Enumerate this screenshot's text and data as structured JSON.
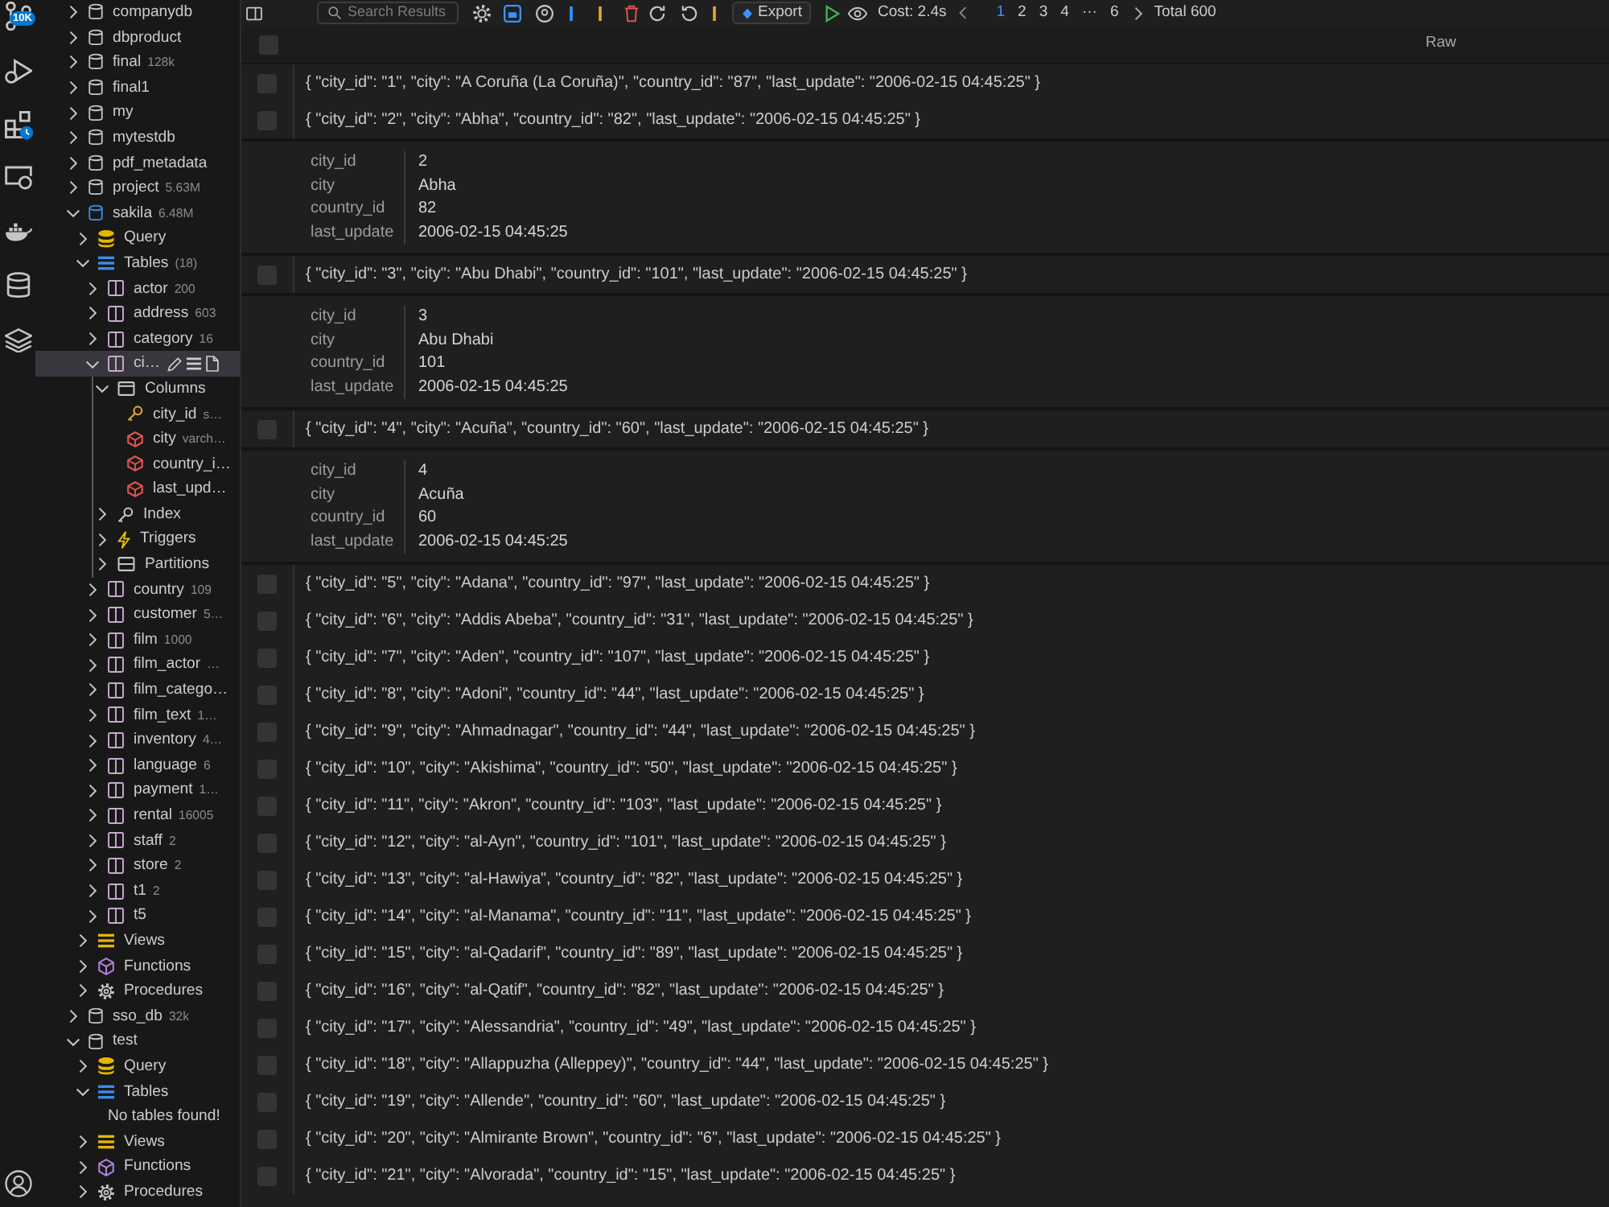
{
  "activity_bar": {
    "badge": "10K"
  },
  "sidebar": {
    "tree": [
      {
        "kind": "database",
        "label": "companydb",
        "expanded": false,
        "selected": false,
        "active": false
      },
      {
        "kind": "database",
        "label": "dbproduct",
        "expanded": false,
        "selected": false,
        "active": false
      },
      {
        "kind": "database",
        "label": "final",
        "meta": "128k",
        "expanded": false,
        "selected": false,
        "active": false
      },
      {
        "kind": "database",
        "label": "final1",
        "expanded": false,
        "selected": false,
        "active": false
      },
      {
        "kind": "database",
        "label": "my",
        "expanded": false,
        "selected": false,
        "active": false
      },
      {
        "kind": "database",
        "label": "mytestdb",
        "expanded": false,
        "selected": false,
        "active": false
      },
      {
        "kind": "database",
        "label": "pdf_metadata",
        "expanded": false,
        "selected": false,
        "active": false
      },
      {
        "kind": "database",
        "label": "project",
        "meta": "5.63M",
        "expanded": false,
        "selected": false,
        "active": false
      },
      {
        "kind": "database",
        "label": "sakila",
        "meta": "6.48M",
        "expanded": true,
        "selected": false,
        "active": true,
        "children": [
          {
            "kind": "query",
            "label": "Query",
            "expanded": false,
            "selected": false
          },
          {
            "kind": "tables",
            "label": "Tables",
            "meta": "(18)",
            "expanded": true,
            "selected": false,
            "children": [
              {
                "kind": "table",
                "label": "actor",
                "meta": "200",
                "expanded": false,
                "selected": false
              },
              {
                "kind": "table",
                "label": "address",
                "meta": "603",
                "expanded": false,
                "selected": false
              },
              {
                "kind": "table",
                "label": "category",
                "meta": "16",
                "expanded": false,
                "selected": false
              },
              {
                "kind": "table",
                "label": "ci…",
                "expanded": true,
                "selected": true,
                "children": [
                  {
                    "kind": "columns",
                    "label": "Columns",
                    "expanded": true,
                    "selected": false,
                    "children": [
                      {
                        "kind": "key",
                        "label": "city_id",
                        "meta": "s…",
                        "selected": false
                      },
                      {
                        "kind": "column",
                        "label": "city",
                        "meta": "varch…",
                        "selected": false
                      },
                      {
                        "kind": "column",
                        "label": "country_i…",
                        "selected": false
                      },
                      {
                        "kind": "column",
                        "label": "last_upd…",
                        "selected": false
                      }
                    ]
                  },
                  {
                    "kind": "index",
                    "label": "Index",
                    "expanded": false,
                    "selected": false
                  },
                  {
                    "kind": "triggers",
                    "label": "Triggers",
                    "expanded": false,
                    "selected": false
                  },
                  {
                    "kind": "partitions",
                    "label": "Partitions",
                    "expanded": false,
                    "selected": false
                  }
                ]
              },
              {
                "kind": "table",
                "label": "country",
                "meta": "109",
                "expanded": false,
                "selected": false
              },
              {
                "kind": "table",
                "label": "customer",
                "meta": "5…",
                "expanded": false,
                "selected": false
              },
              {
                "kind": "table",
                "label": "film",
                "meta": "1000",
                "expanded": false,
                "selected": false
              },
              {
                "kind": "table",
                "label": "film_actor",
                "meta": "…",
                "expanded": false,
                "selected": false
              },
              {
                "kind": "table",
                "label": "film_catego…",
                "expanded": false,
                "selected": false
              },
              {
                "kind": "table",
                "label": "film_text",
                "meta": "1…",
                "expanded": false,
                "selected": false
              },
              {
                "kind": "table",
                "label": "inventory",
                "meta": "4…",
                "expanded": false,
                "selected": false
              },
              {
                "kind": "table",
                "label": "language",
                "meta": "6",
                "expanded": false,
                "selected": false
              },
              {
                "kind": "table",
                "label": "payment",
                "meta": "1…",
                "expanded": false,
                "selected": false
              },
              {
                "kind": "table",
                "label": "rental",
                "meta": "16005",
                "expanded": false,
                "selected": false
              },
              {
                "kind": "table",
                "label": "staff",
                "meta": "2",
                "expanded": false,
                "selected": false
              },
              {
                "kind": "table",
                "label": "store",
                "meta": "2",
                "expanded": false,
                "selected": false
              },
              {
                "kind": "table",
                "label": "t1",
                "meta": "2",
                "expanded": false,
                "selected": false
              },
              {
                "kind": "table",
                "label": "t5",
                "expanded": false,
                "selected": false
              }
            ]
          },
          {
            "kind": "views",
            "label": "Views",
            "expanded": false,
            "selected": false
          },
          {
            "kind": "functions",
            "label": "Functions",
            "expanded": false,
            "selected": false
          },
          {
            "kind": "procedures",
            "label": "Procedures",
            "expanded": false,
            "selected": false
          }
        ]
      },
      {
        "kind": "database",
        "label": "sso_db",
        "meta": "32k",
        "expanded": false,
        "selected": false,
        "active": false
      },
      {
        "kind": "database",
        "label": "test",
        "expanded": true,
        "selected": false,
        "active": false,
        "children": [
          {
            "kind": "query",
            "label": "Query",
            "expanded": false,
            "selected": false
          },
          {
            "kind": "tables",
            "label": "Tables",
            "expanded": true,
            "selected": false,
            "children": [
              {
                "kind": "message",
                "label": "No tables found!",
                "selected": false
              }
            ]
          },
          {
            "kind": "views",
            "label": "Views",
            "expanded": false,
            "selected": false
          },
          {
            "kind": "functions",
            "label": "Functions",
            "expanded": false,
            "selected": false
          },
          {
            "kind": "procedures",
            "label": "Procedures",
            "expanded": false,
            "selected": false
          }
        ]
      }
    ]
  },
  "toolbar": {
    "search": {
      "placeholder": "Search Results"
    },
    "export": "Export",
    "cost": "Cost: 2.4s",
    "pages": [
      {
        "label": "1",
        "selected": true
      },
      {
        "label": "2",
        "selected": false
      },
      {
        "label": "3",
        "selected": false
      },
      {
        "label": "4",
        "selected": false
      },
      {
        "label": "···",
        "selected": false
      },
      {
        "label": "6",
        "selected": false
      }
    ],
    "total": "Total 600"
  },
  "results": {
    "header": {
      "checked": false,
      "columns": [
        "Raw"
      ]
    },
    "rows": [
      {
        "checked": false,
        "raw": "{ \"city_id\": \"1\", \"city\": \"A Coruña (La Coruña)\", \"country_id\": \"87\", \"last_update\": \"2006-02-15 04:45:25\" }"
      },
      {
        "checked": false,
        "raw": "{ \"city_id\": \"2\", \"city\": \"Abha\", \"country_id\": \"82\", \"last_update\": \"2006-02-15 04:45:25\" }",
        "fields": [
          {
            "key": "city_id",
            "value": "2"
          },
          {
            "key": "city",
            "value": "Abha"
          },
          {
            "key": "country_id",
            "value": "82"
          },
          {
            "key": "last_update",
            "value": "2006-02-15 04:45:25"
          }
        ]
      },
      {
        "checked": false,
        "raw": "{ \"city_id\": \"3\", \"city\": \"Abu Dhabi\", \"country_id\": \"101\", \"last_update\": \"2006-02-15 04:45:25\" }",
        "fields": [
          {
            "key": "city_id",
            "value": "3"
          },
          {
            "key": "city",
            "value": "Abu Dhabi"
          },
          {
            "key": "country_id",
            "value": "101"
          },
          {
            "key": "last_update",
            "value": "2006-02-15 04:45:25"
          }
        ]
      },
      {
        "checked": false,
        "raw": "{ \"city_id\": \"4\", \"city\": \"Acuña\", \"country_id\": \"60\", \"last_update\": \"2006-02-15 04:45:25\" }",
        "fields": [
          {
            "key": "city_id",
            "value": "4"
          },
          {
            "key": "city",
            "value": "Acuña"
          },
          {
            "key": "country_id",
            "value": "60"
          },
          {
            "key": "last_update",
            "value": "2006-02-15 04:45:25"
          }
        ]
      },
      {
        "checked": false,
        "raw": "{ \"city_id\": \"5\", \"city\": \"Adana\", \"country_id\": \"97\", \"last_update\": \"2006-02-15 04:45:25\" }"
      },
      {
        "checked": false,
        "raw": "{ \"city_id\": \"6\", \"city\": \"Addis Abeba\", \"country_id\": \"31\", \"last_update\": \"2006-02-15 04:45:25\" }"
      },
      {
        "checked": false,
        "raw": "{ \"city_id\": \"7\", \"city\": \"Aden\", \"country_id\": \"107\", \"last_update\": \"2006-02-15 04:45:25\" }"
      },
      {
        "checked": false,
        "raw": "{ \"city_id\": \"8\", \"city\": \"Adoni\", \"country_id\": \"44\", \"last_update\": \"2006-02-15 04:45:25\" }"
      },
      {
        "checked": false,
        "raw": "{ \"city_id\": \"9\", \"city\": \"Ahmadnagar\", \"country_id\": \"44\", \"last_update\": \"2006-02-15 04:45:25\" }"
      },
      {
        "checked": false,
        "raw": "{ \"city_id\": \"10\", \"city\": \"Akishima\", \"country_id\": \"50\", \"last_update\": \"2006-02-15 04:45:25\" }"
      },
      {
        "checked": false,
        "raw": "{ \"city_id\": \"11\", \"city\": \"Akron\", \"country_id\": \"103\", \"last_update\": \"2006-02-15 04:45:25\" }"
      },
      {
        "checked": false,
        "raw": "{ \"city_id\": \"12\", \"city\": \"al-Ayn\", \"country_id\": \"101\", \"last_update\": \"2006-02-15 04:45:25\" }"
      },
      {
        "checked": false,
        "raw": "{ \"city_id\": \"13\", \"city\": \"al-Hawiya\", \"country_id\": \"82\", \"last_update\": \"2006-02-15 04:45:25\" }"
      },
      {
        "checked": false,
        "raw": "{ \"city_id\": \"14\", \"city\": \"al-Manama\", \"country_id\": \"11\", \"last_update\": \"2006-02-15 04:45:25\" }"
      },
      {
        "checked": false,
        "raw": "{ \"city_id\": \"15\", \"city\": \"al-Qadarif\", \"country_id\": \"89\", \"last_update\": \"2006-02-15 04:45:25\" }"
      },
      {
        "checked": false,
        "raw": "{ \"city_id\": \"16\", \"city\": \"al-Qatif\", \"country_id\": \"82\", \"last_update\": \"2006-02-15 04:45:25\" }"
      },
      {
        "checked": false,
        "raw": "{ \"city_id\": \"17\", \"city\": \"Alessandria\", \"country_id\": \"49\", \"last_update\": \"2006-02-15 04:45:25\" }"
      },
      {
        "checked": false,
        "raw": "{ \"city_id\": \"18\", \"city\": \"Allappuzha (Alleppey)\", \"country_id\": \"44\", \"last_update\": \"2006-02-15 04:45:25\" }"
      },
      {
        "checked": false,
        "raw": "{ \"city_id\": \"19\", \"city\": \"Allende\", \"country_id\": \"60\", \"last_update\": \"2006-02-15 04:45:25\" }"
      },
      {
        "checked": false,
        "raw": "{ \"city_id\": \"20\", \"city\": \"Almirante Brown\", \"country_id\": \"6\", \"last_update\": \"2006-02-15 04:45:25\" }"
      },
      {
        "checked": false,
        "raw": "{ \"city_id\": \"21\", \"city\": \"Alvorada\", \"country_id\": \"15\", \"last_update\": \"2006-02-15 04:45:25\" }"
      }
    ]
  }
}
